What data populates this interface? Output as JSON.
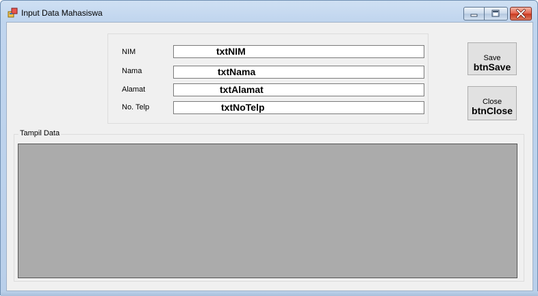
{
  "window": {
    "title": "Input Data Mahasiswa",
    "icons": {
      "app": "form-icon",
      "minimize": "minimize-icon",
      "maximize": "maximize-icon",
      "close": "close-icon"
    }
  },
  "form": {
    "fields": [
      {
        "label": "NIM",
        "value": "txtNIM"
      },
      {
        "label": "Nama",
        "value": "txtNama"
      },
      {
        "label": "Alamat",
        "value": "txtAlamat"
      },
      {
        "label": "No. Telp",
        "value": "txtNoTelp"
      }
    ]
  },
  "buttons": {
    "save": {
      "text": "Save",
      "name": "btnSave"
    },
    "close": {
      "text": "Close",
      "name": "btnClose"
    }
  },
  "group": {
    "title": "Tampil Data"
  },
  "colors": {
    "grid_background": "#ababab",
    "client_background": "#f0f0f0"
  }
}
